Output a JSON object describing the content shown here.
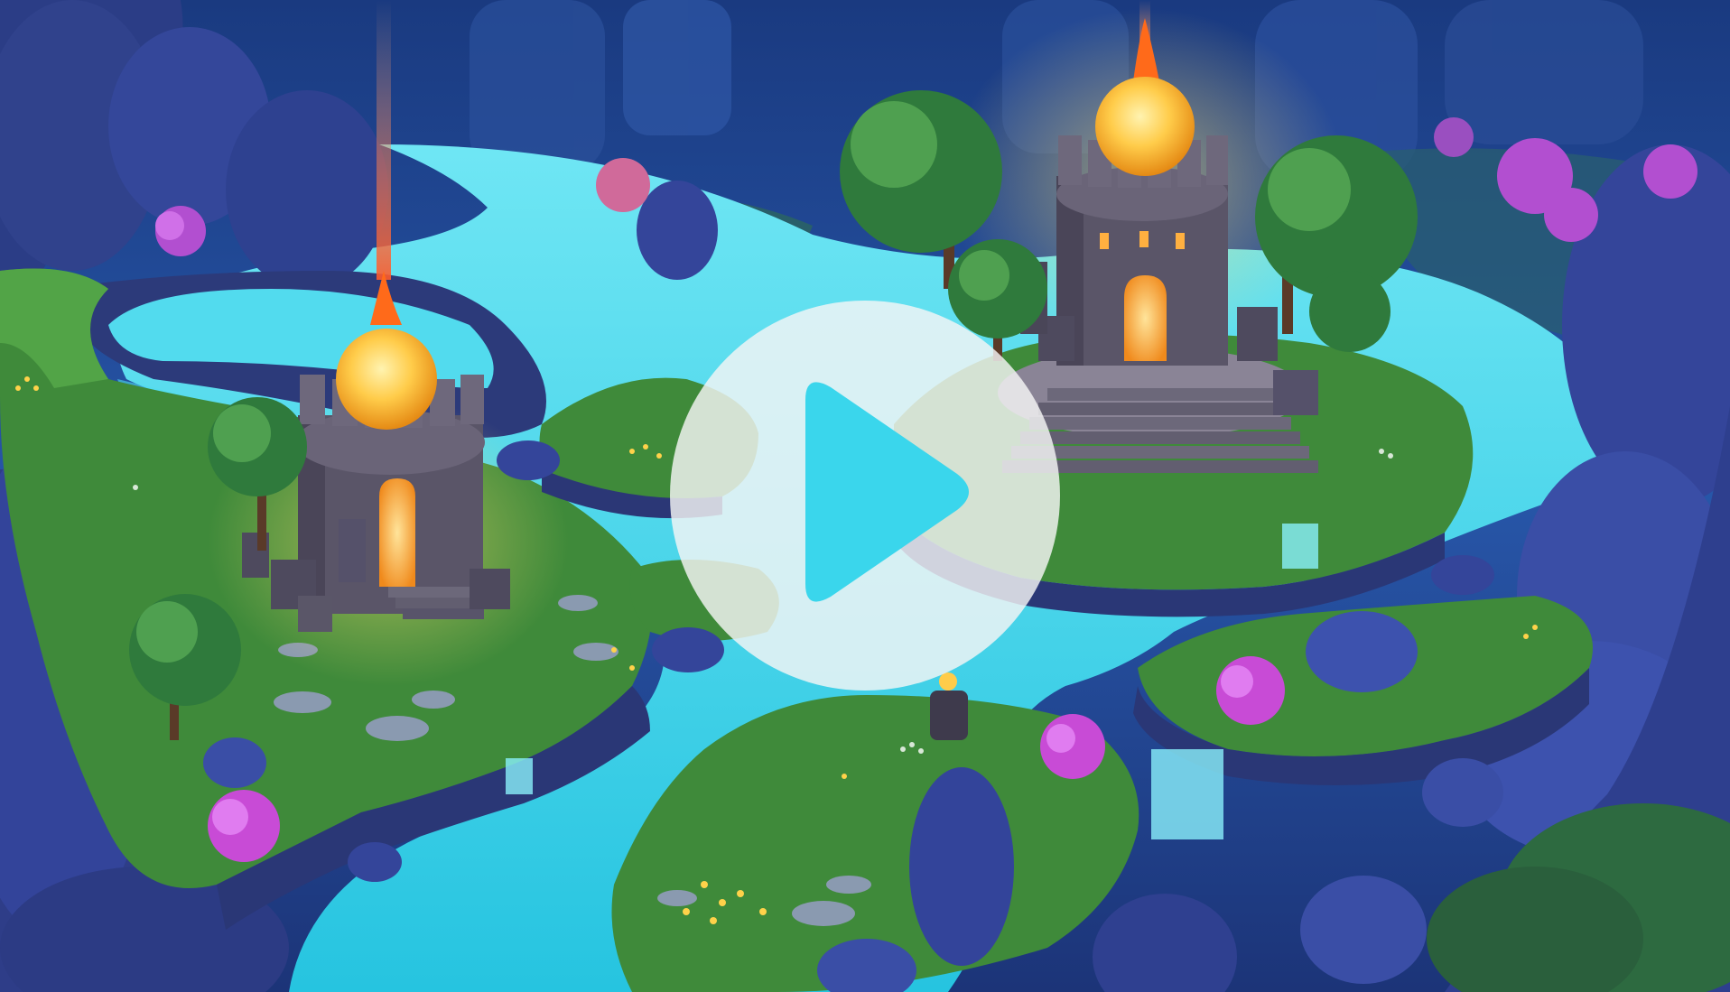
{
  "video": {
    "state": "paused",
    "play_icon": "play-triangle-icon"
  },
  "colors": {
    "sky_top": "#1d3a86",
    "sky_mid": "#2c5fb8",
    "water": "#3ad6ec",
    "water_deep": "#1fb3d8",
    "grass": "#3f8a3a",
    "grass_light": "#5aa64a",
    "cliff": "#2b3a78",
    "rock": "#34418c",
    "rock_light": "#4a5bb0",
    "tower_stone": "#5a5568",
    "tower_dark": "#3e3a4c",
    "orb": "#ffcc4a",
    "fire": "#ff6a1a",
    "tree": "#2f7a3c",
    "tree_light": "#4fa050",
    "flower_pink": "#c84bd6",
    "play_circle": "#f5f5f5",
    "play_triangle": "#3ad6ec"
  },
  "scene": {
    "towers": [
      "left-tower",
      "right-tower"
    ],
    "islands": [
      "left-island",
      "center-island",
      "right-island",
      "bottom-island",
      "right-lower-island"
    ]
  }
}
